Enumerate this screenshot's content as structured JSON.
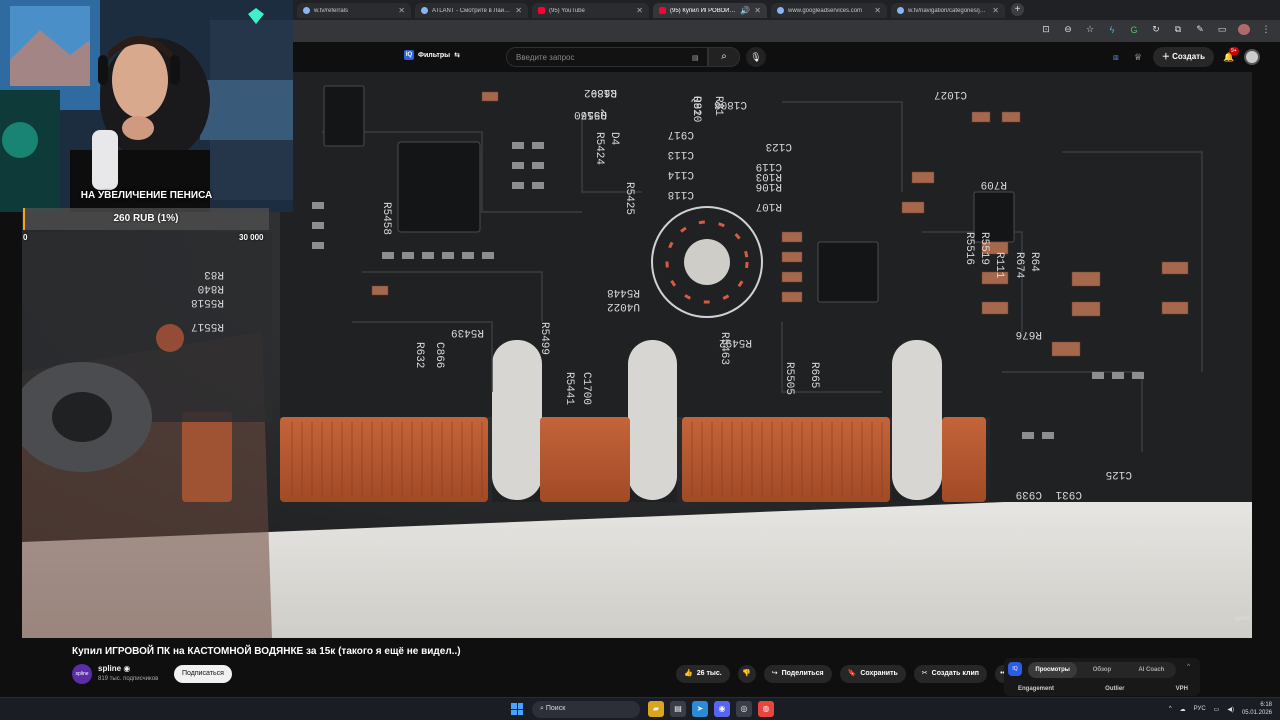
{
  "browser": {
    "tabs": [
      {
        "title": "w.tv/referrals",
        "favicon": "generic-icon",
        "active": false
      },
      {
        "title": "ATLANT - Смотрите в Лайве ...",
        "favicon": "generic-icon",
        "active": false
      },
      {
        "title": "(95) YouTube",
        "favicon": "youtube-icon",
        "active": false
      },
      {
        "title": "(95) Купил ИГРОВОЙ ПК н...",
        "favicon": "youtube-icon",
        "active": true
      },
      {
        "title": "www.googleadservices.com",
        "favicon": "generic-icon",
        "active": false
      },
      {
        "title": "w.tv/navigation/categories/jus...",
        "favicon": "generic-icon",
        "active": false
      }
    ],
    "new_tab": "+"
  },
  "youtube": {
    "filters_label": "Фильтры",
    "search_placeholder": "Введите запрос",
    "search_icon": "⌕",
    "create_label": "Создать",
    "notifications_badge": "9+",
    "video_title": "Купил ИГРОВОЙ ПК на КАСТОМНОЙ ВОДЯНКЕ за 15к (такого я ещё не видел..)",
    "channel_name": "spline ◉",
    "channel_subs": "819 тыс. подписчиков",
    "channel_avatar_text": "spline",
    "subscribe_label": "Подписаться",
    "likes": "26 тыс.",
    "share_label": "Поделиться",
    "save_label": "Сохранить",
    "clip_label": "Создать клип",
    "more_label": "•••",
    "watermark": "spline"
  },
  "vidiq": {
    "logo": "IQ",
    "tabs": [
      {
        "label": "Просмотры",
        "active": true
      },
      {
        "label": "Обзор",
        "active": false
      },
      {
        "label": "AI Coach",
        "active": false
      }
    ],
    "metrics": [
      "Engagement",
      "Outlier",
      "VPH"
    ]
  },
  "stream_overlay": {
    "donation_goal_title": "НА УВЕЛИЧЕНИЕ ПЕНИСА",
    "goal_text": "260 RUB (1%)",
    "goal_progress": 0.01,
    "goal_min": "0",
    "goal_max": "30 000",
    "accent": "#f7a21b"
  },
  "pcb_labels": [
    "C1802",
    "R5570",
    "R82",
    "R81",
    "C1808",
    "C917",
    "C113",
    "C114",
    "C118",
    "C119",
    "R106",
    "R107",
    "R103",
    "C123",
    "D4",
    "R5424",
    "R5425",
    "R5458",
    "U4022",
    "R5448",
    "R5439",
    "R5499",
    "R5441",
    "C1700",
    "R5463",
    "R5492",
    "R632",
    "C866",
    "R5505",
    "R665",
    "R83",
    "R840",
    "R5518",
    "R5517",
    "R5516",
    "R5519",
    "R111",
    "R674",
    "R64",
    "R676",
    "C125",
    "C939",
    "C931",
    "C1027",
    "R709",
    "R689",
    "Q916",
    "Q910"
  ],
  "taskbar": {
    "search_label": "Поиск",
    "lang": "РУС",
    "time": "6:18",
    "date": "05.01.2026"
  }
}
